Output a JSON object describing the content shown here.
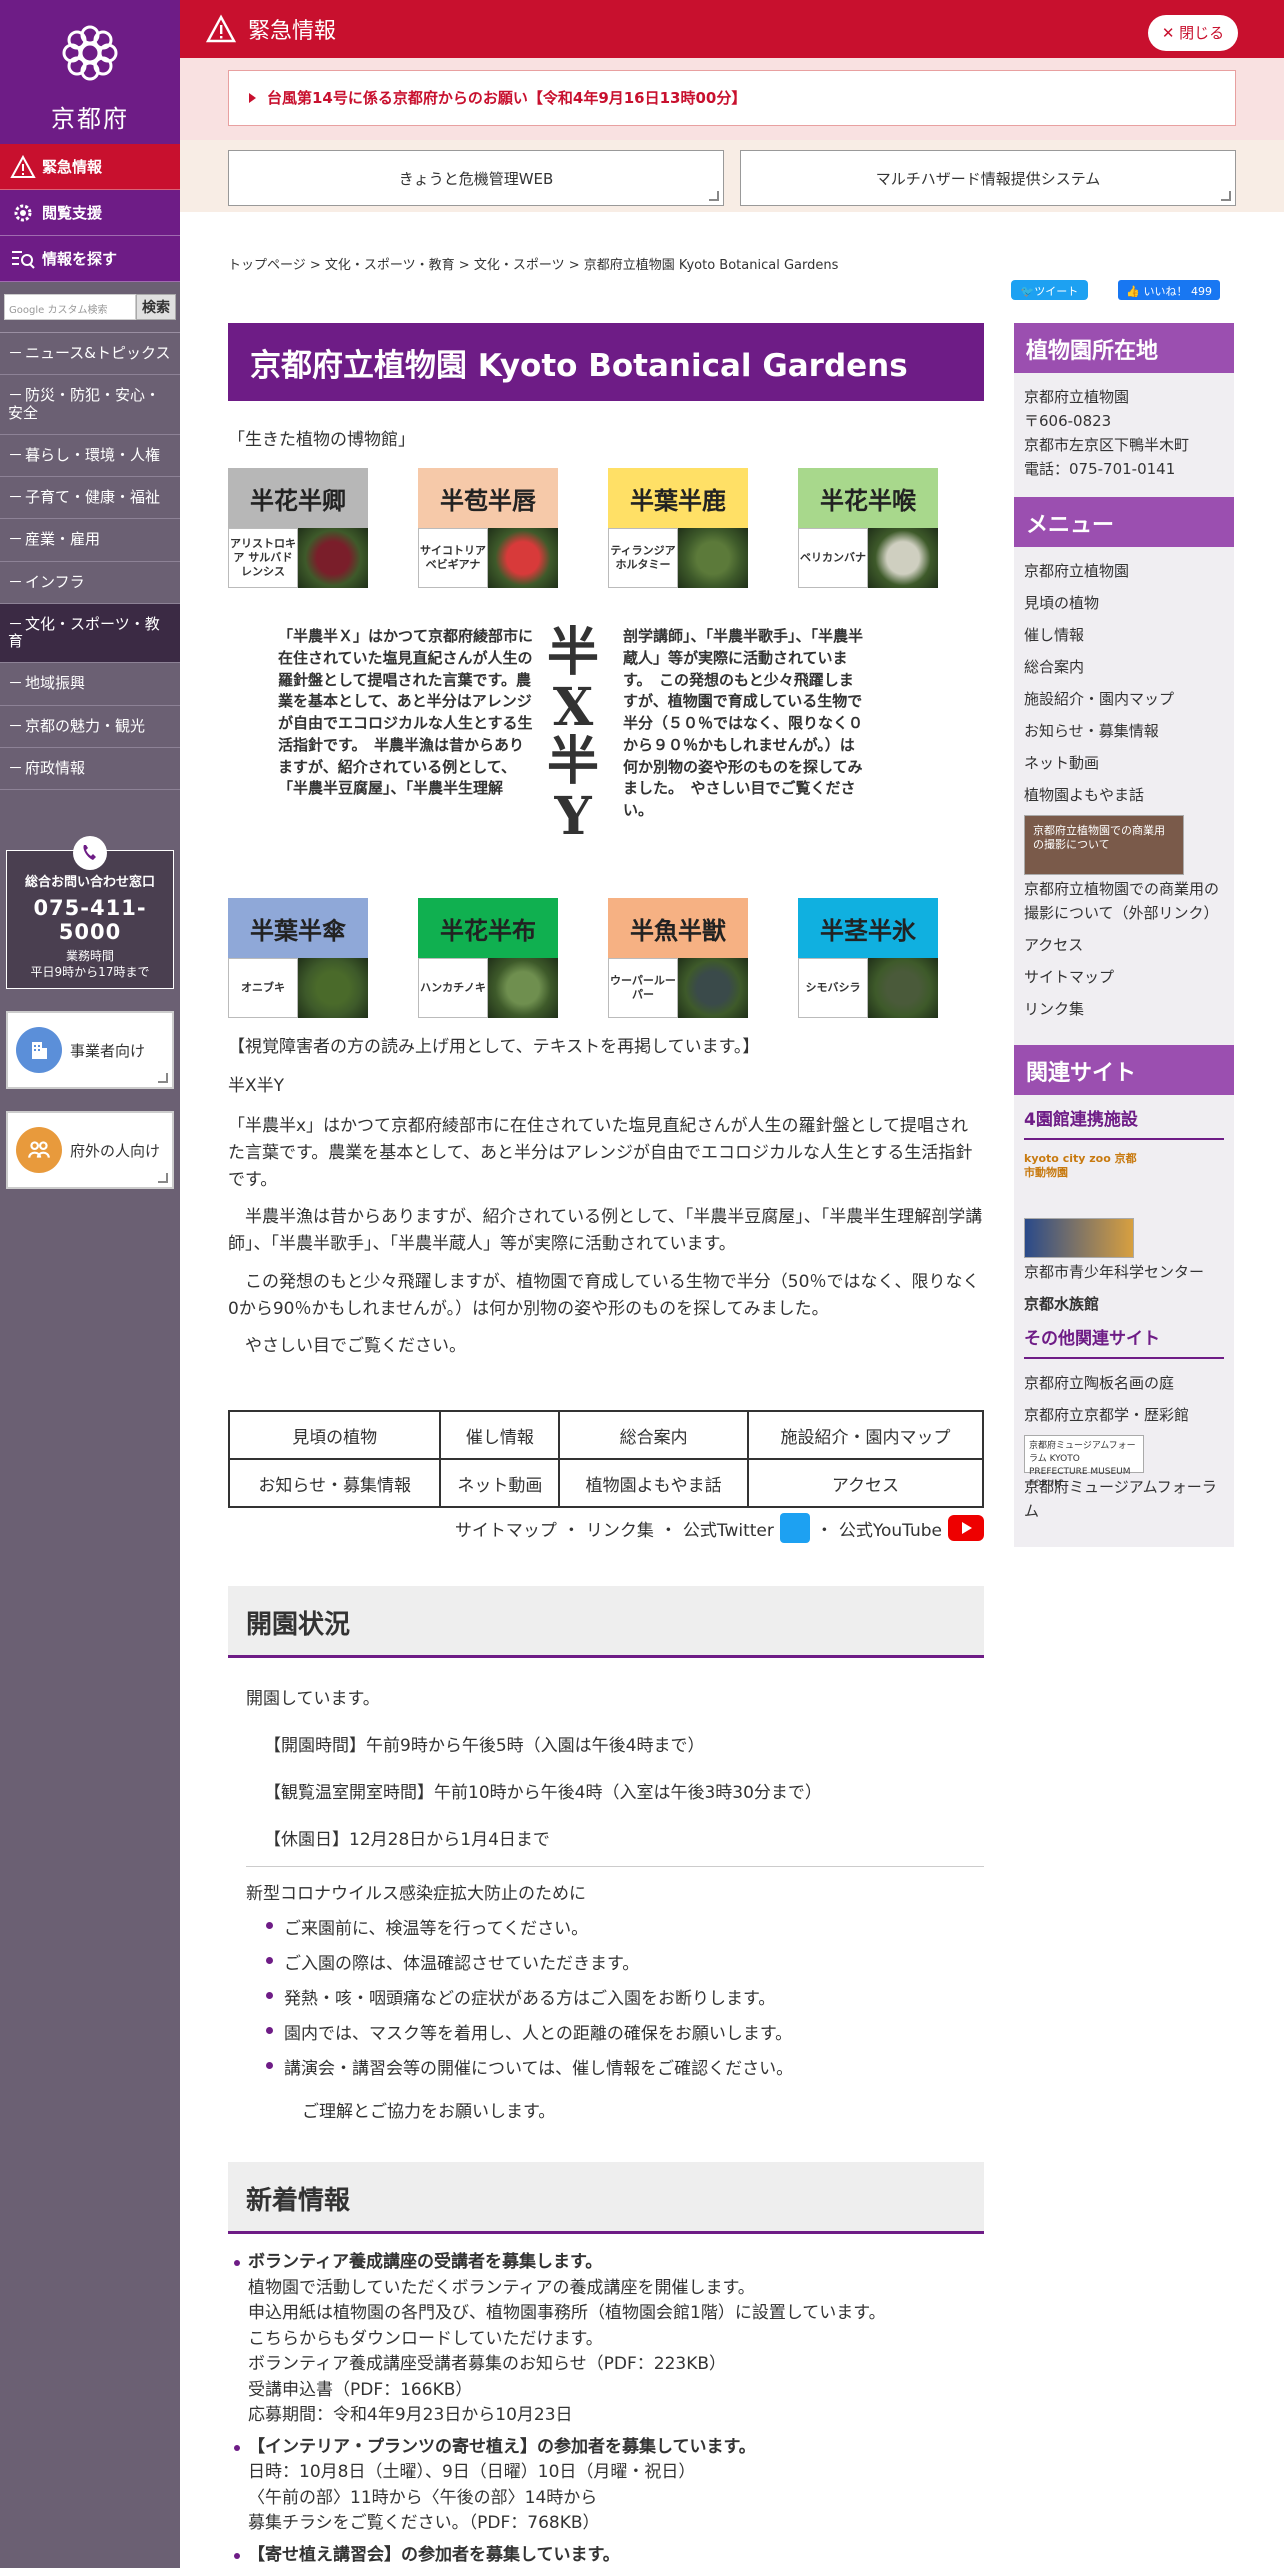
{
  "sidebar": {
    "logo_text": "京都府",
    "emergency_btn": "緊急情報",
    "accessibility_btn": "閲覧支援",
    "find_info_btn": "情報を探す",
    "search": {
      "placeholder": "Google カスタム検索",
      "button": "検索"
    },
    "nav": [
      "ニュース&トピックス",
      "防災・防犯・安心・安全",
      "暮らし・環境・人権",
      "子育て・健康・福祉",
      "産業・雇用",
      "インフラ",
      "文化・スポーツ・教育",
      "地域振興",
      "京都の魅力・観光",
      "府政情報"
    ],
    "contact": {
      "title": "総合お問い合わせ窓口",
      "phone": "075-411-5000",
      "hours_label": "業務時間",
      "hours": "平日9時から17時まで"
    },
    "business_btn": "事業者向け",
    "outside_btn": "府外の人向け"
  },
  "emergency": {
    "title": "緊急情報",
    "close": "閉じる",
    "notice": "台風第14号に係る京都府からのお願い【令和4年9月16日13時00分】",
    "links": [
      "きょうと危機管理WEB",
      "マルチハザード情報提供システム"
    ]
  },
  "breadcrumb": [
    "トップページ",
    "文化・スポーツ・教育",
    "文化・スポーツ",
    "京都府立植物園 Kyoto Botanical Gardens"
  ],
  "social": {
    "tweet": "ツイート",
    "like": "いいね！ 499"
  },
  "page": {
    "title": "京都府立植物園 Kyoto Botanical Gardens",
    "subtitle": "「生きた植物の博物館」",
    "tiles_row1": [
      {
        "title": "半花半卿",
        "label": "アリストロキア サルバドレンシス",
        "color": "#b7b7b7",
        "img": "#7a1e2a"
      },
      {
        "title": "半苞半唇",
        "label": "サイコトリア ベビギアナ",
        "color": "#f6c9a9",
        "img": "#d83a3a"
      },
      {
        "title": "半葉半鹿",
        "label": "ティランジア ホルタミー",
        "color": "#ffe066",
        "img": "#5c7a3a"
      },
      {
        "title": "半花半喉",
        "label": "ベリカンバナ",
        "color": "#a8d88c",
        "img": "#cfcfc0"
      }
    ],
    "xy_left": "「半農半Ｘ」はかつて京都府綾部市に在住されていた塩見直紀さんが人生の羅針盤として提唱された言葉です。農業を基本として、あと半分はアレンジが自由でエコロジカルな人生とする生活指針です。　半農半漁は昔からありますが、紹介されている例として、「半農半豆腐屋」、「半農半生理解",
    "xy_center": [
      "半",
      "X",
      "半",
      "Y"
    ],
    "xy_right": "剖学講師」、「半農半歌手」、「半農半蔵人」等が実際に活動されています。　この発想のもと少々飛躍しますが、植物園で育成している生物で半分（５０％ではなく、限りなく０から９０％かもしれませんが。）は何か別物の姿や形のものを探してみました。　やさしい目でご覧ください。",
    "tiles_row2": [
      {
        "title": "半葉半傘",
        "label": "オニブキ",
        "color": "#8fa8d8",
        "img": "#4a6a2a"
      },
      {
        "title": "半花半布",
        "label": "ハンカチノキ",
        "color": "#10b050",
        "img": "#6f8f4f"
      },
      {
        "title": "半魚半獣",
        "label": "ウーパールーパー",
        "color": "#f6b183",
        "img": "#3a4a4a"
      },
      {
        "title": "半茎半氷",
        "label": "シモバシラ",
        "color": "#10b0e0",
        "img": "#4a5a3a"
      }
    ],
    "readout_note": "【視覚障害者の方の読み上げ用として、テキストを再掲しています。】",
    "readout_title": "半X半Y",
    "readout_p1": "「半農半x」はかつて京都府綾部市に在住されていた塩見直紀さんが人生の羅針盤として提唱された言葉です。農業を基本として、あと半分はアレンジが自由でエコロジカルな人生とする生活指針です。",
    "readout_p2": "半農半漁は昔からありますが、紹介されている例として、「半農半豆腐屋」、「半農半生理解剖学講師」、「半農半歌手」、「半農半蔵人」等が実際に活動されています。",
    "readout_p3": "この発想のもと少々飛躍しますが、植物園で育成している生物で半分（50％ではなく、限りなく0から90％かもしれませんが。）は何か別物の姿や形のものを探してみました。",
    "readout_p4": "やさしい目でご覧ください。",
    "nav_table": [
      [
        "見頃の植物",
        "催し情報",
        "総合案内",
        "施設紹介・園内マップ"
      ],
      [
        "お知らせ・募集情報",
        "ネット動画",
        "植物園よもやま話",
        "アクセス"
      ]
    ],
    "ext_links": {
      "sitemap": "サイトマップ",
      "links": "リンク集",
      "twitter": "公式Twitter",
      "youtube": "公式YouTube",
      "sep": "・"
    }
  },
  "status": {
    "title": "開園状況",
    "open": "開園しています。",
    "hours": "【開園時間】午前9時から午後5時（入園は午後4時まで）",
    "greenhouse": "【観覧温室開室時間】午前10時から午後4時（入室は午後3時30分まで）",
    "closed": "【休園日】12月28日から1月4日まで",
    "covid_title": "新型コロナウイルス感染症拡大防止のために",
    "covid": [
      "ご来園前に、検温等を行ってください。",
      "ご入園の際は、体温確認させていただきます。",
      "発熱・咳・咽頭痛などの症状がある方はご入園をお断りします。",
      "園内では、マスク等を着用し、人との距離の確保をお願いします。"
    ],
    "covid_last_pre": "講演会・講習会等の開催については、",
    "covid_last_link": "催し情報",
    "covid_last_post": "をご確認ください。",
    "thanks": "ご理解とご協力をお願いします。"
  },
  "news": {
    "title": "新着情報",
    "item1": {
      "title": "ボランティア養成講座の受講者を募集します。",
      "l1": "植物園で活動していただくボランティアの養成講座を開催します。",
      "l2": "申込用紙は植物園の各門及び、植物園事務所（植物園会館1階）に設置しています。",
      "l3": "こちらからもダウンロードしていただけます。",
      "link1": "ボランティア養成講座受講者募集のお知らせ（PDF：223KB）",
      "link2": "受講申込書（PDF：166KB）",
      "period": "応募期間：令和4年9月23日から10月23日"
    },
    "item2": {
      "title": "【インテリア・プランツの寄せ植え】の参加者を募集しています。",
      "l1": "日時：10月8日（土曜）、9日（日曜）10日（月曜・祝日）",
      "l2": "〈午前の部〉11時から〈午後の部〉14時から",
      "link1": "募集チラシをご覧ください。（PDF：768KB）"
    },
    "item3": {
      "title": "【寄せ植え講習会】の参加者を募集しています。"
    }
  },
  "right": {
    "location_title": "植物園所在地",
    "location": [
      "京都府立植物園",
      "〒606-0823",
      "京都市左京区下鴨半木町",
      "電話：075-701-0141"
    ],
    "menu_title": "メニュー",
    "menu": [
      "京都府立植物園",
      "見頃の植物",
      "催し情報",
      "総合案内",
      "施設紹介・園内マップ",
      "お知らせ・募集情報",
      "ネット動画",
      "植物園よもやま話"
    ],
    "banner_text": "京都府立植物園での商業用の撮影について",
    "menu2": [
      "京都府立植物園での商業用の撮影について（外部リンク）",
      "アクセス",
      "サイトマップ",
      "リンク集"
    ],
    "related_title": "関連サイト",
    "partner_title": "4園館連携施設",
    "zoo_logo_text": "kyoto city zoo 京都市動物園",
    "youth_center": "京都市青少年科学センター",
    "aquarium": "京都水族館",
    "other_title": "その他関連サイト",
    "other": [
      "京都府立陶板名画の庭",
      "京都府立京都学・歴彩館"
    ],
    "museum_banner_text": "京都府ミュージアムフォーラム KYOTO PREFECTURE MUSEUM FORUM",
    "museum": "京都府ミュージアムフォーラム"
  },
  "colors": {
    "brand_purple": "#6e1c86",
    "emergency_red": "#c8102e",
    "sidebar_gray": "#6b6073",
    "accent_purple": "#9b4fb0"
  }
}
